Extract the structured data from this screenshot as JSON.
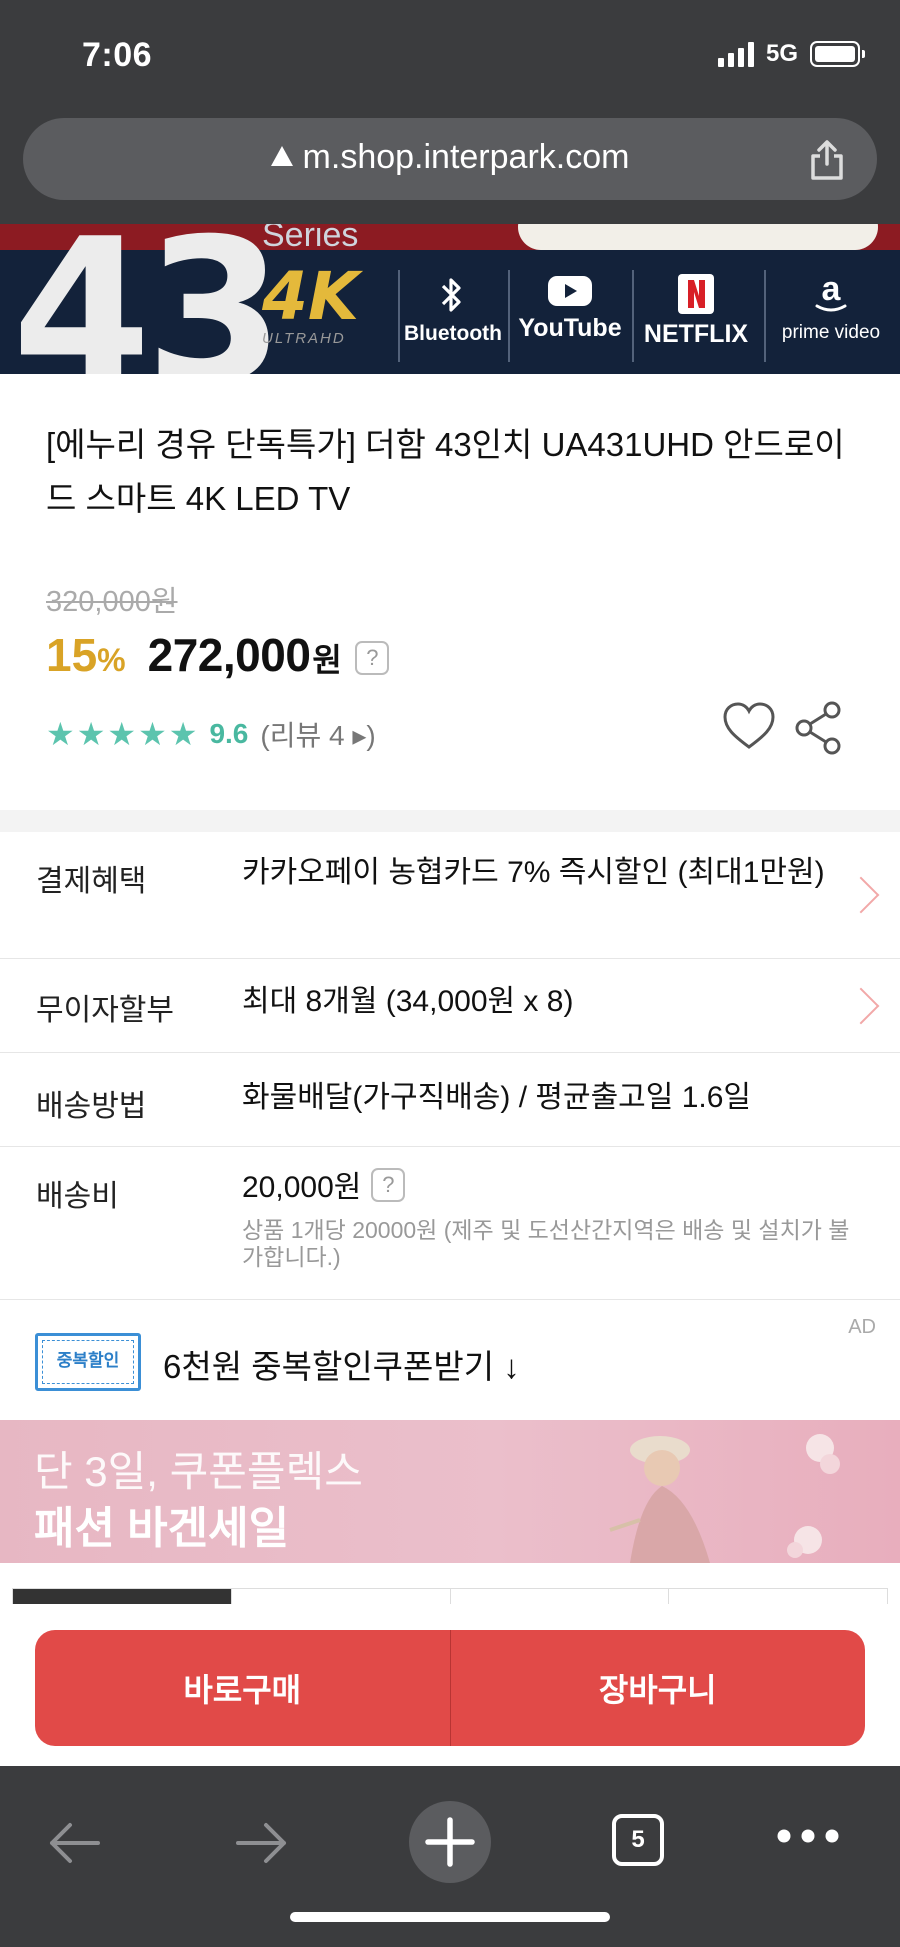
{
  "status_bar": {
    "time": "7:06",
    "network": "5G"
  },
  "browser": {
    "url": "m.shop.interpark.com"
  },
  "banner": {
    "big_number": "43",
    "series_text": "Series",
    "badge_4k": "4K",
    "badge_uhd": "ULTRAHD",
    "brands": [
      "Bluetooth",
      "YouTube",
      "NETFLIX",
      "prime video"
    ]
  },
  "product": {
    "title": "[에누리 경유 단독특가] 더함 43인치 UA431UHD 안드로이드 스마트 4K LED TV",
    "original_price": "320,000원",
    "discount_num": "15",
    "discount_unit": "%",
    "price": "272,000",
    "price_unit": "원",
    "help_mark": "?",
    "stars": "★★★★★",
    "rating": "9.6",
    "review_text": "(리뷰 4 ▸)"
  },
  "info_rows": [
    {
      "label": "결제혜택",
      "value": "카카오페이 농협카드 7% 즉시할인 (최대1만원)"
    },
    {
      "label": "무이자할부",
      "value": "최대 8개월 (34,000원 x 8)"
    },
    {
      "label": "배송방법",
      "value": "화물배달(가구직배송) / 평균출고일 1.6일"
    },
    {
      "label": "배송비",
      "value": "20,000원",
      "help": "?",
      "note": "상품 1개당 20000원 (제주 및 도선산간지역은 배송 및 설치가 불가합니다.)"
    }
  ],
  "coupon": {
    "badge": "중복할인",
    "text": "6천원 중복할인쿠폰받기 ↓",
    "ad_tag": "AD"
  },
  "ad_banner": {
    "line1": "단 3일, 쿠폰플렉스",
    "line2": "패션 바겐세일"
  },
  "actions": {
    "buy_now": "바로구매",
    "cart": "장바구니"
  },
  "toolbar": {
    "tab_count": "5"
  },
  "colors": {
    "accent": "#e14a48",
    "discount": "#d9a326",
    "rating": "#5cc4ae",
    "chrome": "#3b3c3e"
  }
}
